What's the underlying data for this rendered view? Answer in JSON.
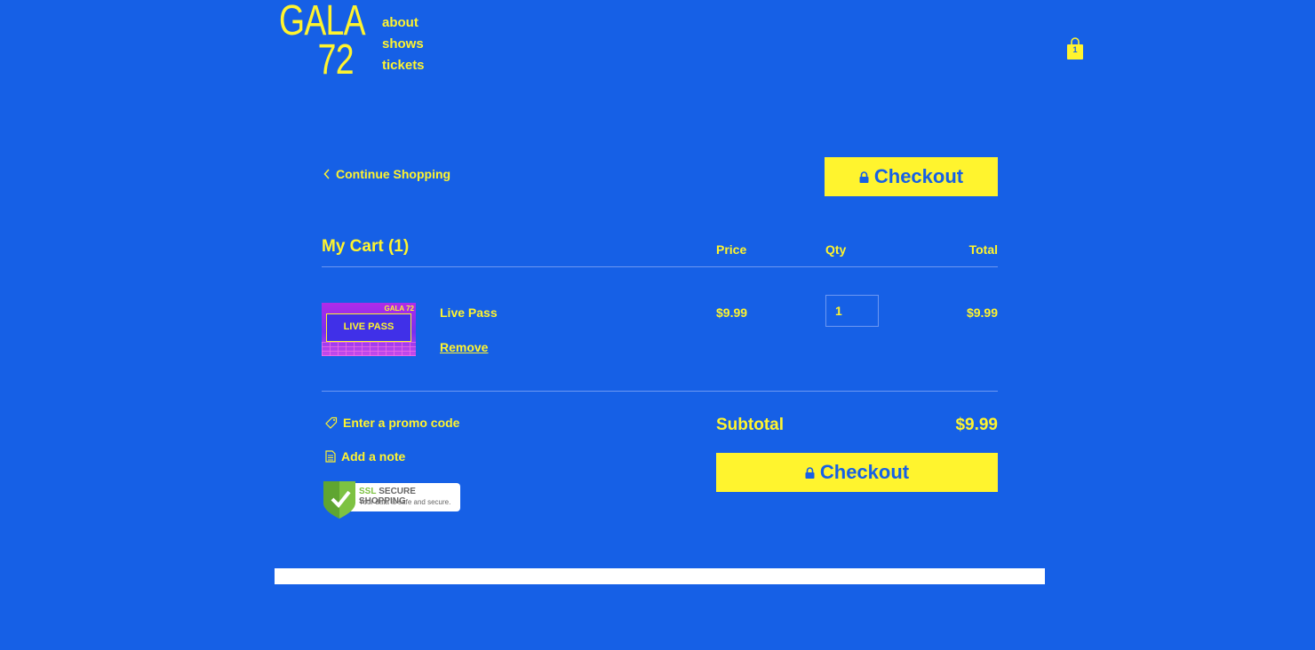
{
  "brand": {
    "logo_line1": "GALA",
    "logo_line2": "72"
  },
  "nav": {
    "items": [
      {
        "label": "about"
      },
      {
        "label": "shows"
      },
      {
        "label": "tickets"
      }
    ]
  },
  "cart_icon": {
    "count": "1",
    "icon": "shopping-bag-icon"
  },
  "actions": {
    "continue_label": "Continue Shopping",
    "checkout_label": "Checkout"
  },
  "cart": {
    "title": "My Cart (1)",
    "columns": {
      "price": "Price",
      "qty": "Qty",
      "total": "Total"
    },
    "items": [
      {
        "name": "Live Pass",
        "price": "$9.99",
        "qty": "1",
        "total": "$9.99",
        "remove_label": "Remove",
        "thumb_title": "LIVE PASS",
        "thumb_logo": "GALA 72"
      }
    ]
  },
  "extras": {
    "promo_label": "Enter a promo code",
    "note_label": "Add a note"
  },
  "ssl_badge": {
    "title_ssl": "SSL",
    "title_rest": "SECURE SHOPPING",
    "subtitle": "Your data is safe and secure."
  },
  "summary": {
    "subtotal_label": "Subtotal",
    "subtotal_value": "$9.99"
  },
  "colors": {
    "background": "#1660E6",
    "accent": "#FFF42E",
    "divider": "#6D98F2"
  }
}
